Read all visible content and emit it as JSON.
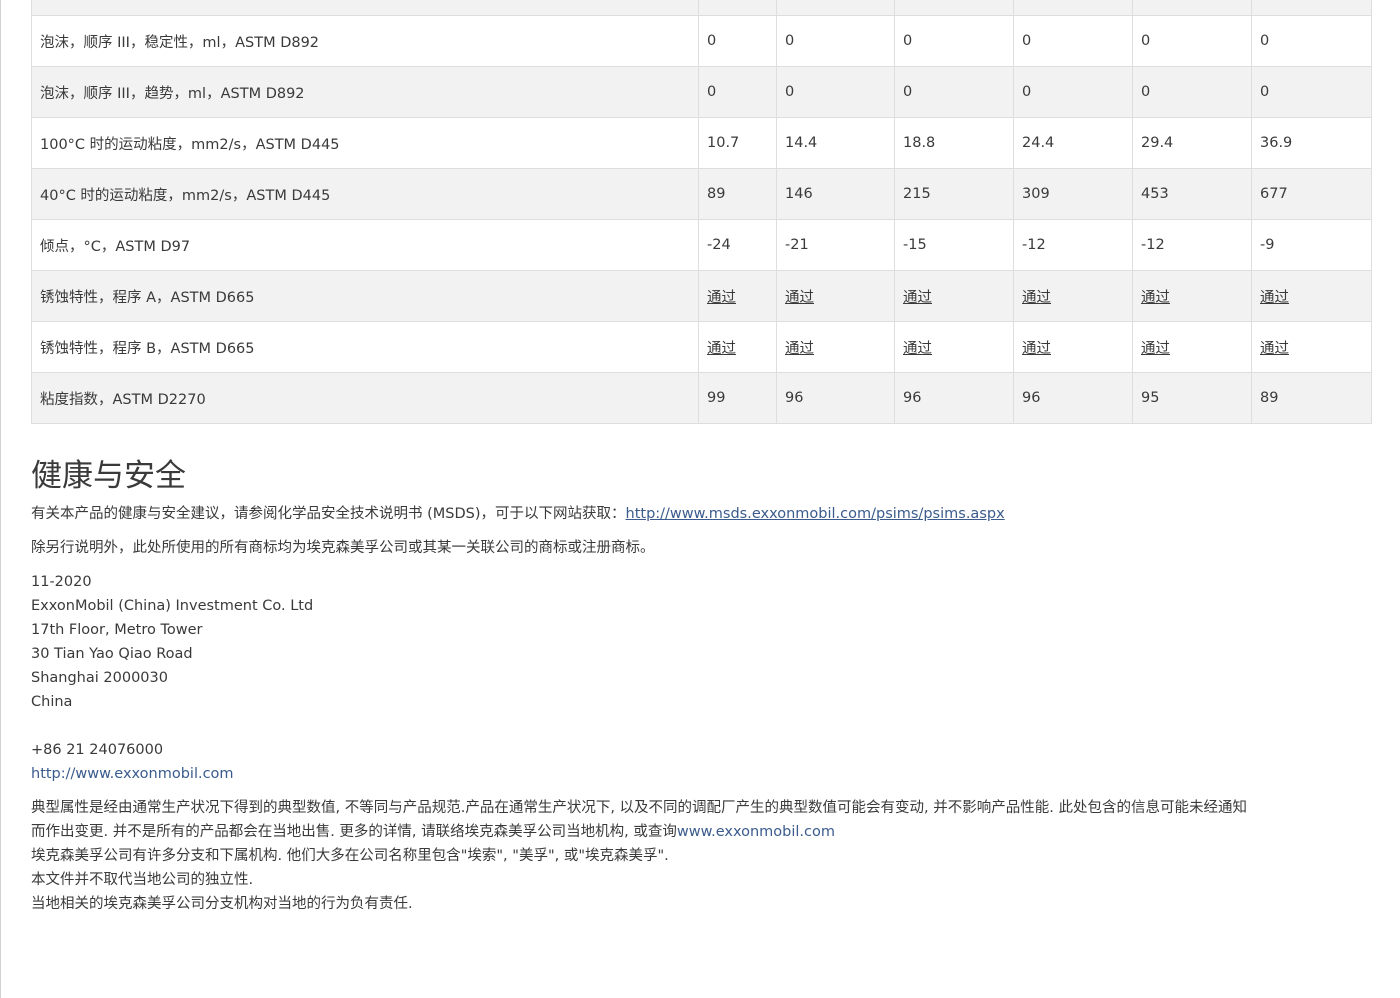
{
  "table": {
    "rows": [
      {
        "label": "",
        "values": [
          "",
          "",
          "",
          "",
          "",
          ""
        ]
      },
      {
        "label": "泡沫，顺序 III，稳定性，ml，ASTM D892",
        "values": [
          "0",
          "0",
          "0",
          "0",
          "0",
          "0"
        ]
      },
      {
        "label": "泡沫，顺序 III，趋势，ml，ASTM D892",
        "values": [
          "0",
          "0",
          "0",
          "0",
          "0",
          "0"
        ]
      },
      {
        "label": "100°C 时的运动粘度，mm2/s，ASTM D445",
        "values": [
          "10.7",
          "14.4",
          "18.8",
          "24.4",
          "29.4",
          "36.9"
        ]
      },
      {
        "label": "40°C 时的运动粘度，mm2/s，ASTM D445",
        "values": [
          "89",
          "146",
          "215",
          "309",
          "453",
          "677"
        ]
      },
      {
        "label": "倾点，°C，ASTM D97",
        "values": [
          "-24",
          "-21",
          "-15",
          "-12",
          "-12",
          "-9"
        ]
      },
      {
        "label": "锈蚀特性，程序 A，ASTM D665",
        "values": [
          "通过",
          "通过",
          "通过",
          "通过",
          "通过",
          "通过"
        ]
      },
      {
        "label": "锈蚀特性，程序 B，ASTM D665",
        "values": [
          "通过",
          "通过",
          "通过",
          "通过",
          "通过",
          "通过"
        ]
      },
      {
        "label": "粘度指数，ASTM D2270",
        "values": [
          "99",
          "96",
          "96",
          "96",
          "95",
          "89"
        ]
      }
    ]
  },
  "health": {
    "title": "健康与安全",
    "msds_text": "有关本产品的健康与安全建议，请参阅化学品安全技术说明书 (MSDS)，可于以下网站获取：",
    "msds_link": "http://www.msds.exxonmobil.com/psims/psims.aspx",
    "trademark_text": "除另行说明外，此处所使用的所有商标均为埃克森美孚公司或其某一关联公司的商标或注册商标。"
  },
  "address": {
    "date": "11-2020",
    "company": "ExxonMobil (China) Investment Co. Ltd",
    "line1": "17th Floor, Metro Tower",
    "line2": "30 Tian Yao Qiao Road",
    "city": "Shanghai 2000030",
    "country": "China",
    "phone": "+86 21 24076000",
    "website": "http://www.exxonmobil.com"
  },
  "disclaimer": {
    "line1": "典型属性是经由通常生产状况下得到的典型数值, 不等同与产品规范.产品在通常生产状况下, 以及不同的调配厂产生的典型数值可能会有变动, 并不影响产品性能. 此处包含的信息可能未经通知",
    "line2": "而作出变更. 并不是所有的产品都会在当地出售. 更多的详情, 请联络埃克森美孚公司当地机构, 或查询",
    "line2_link": "www.exxonmobil.com",
    "line3": "埃克森美孚公司有许多分支和下属机构. 他们大多在公司名称里包含\"埃索\", \"美孚\", 或\"埃克森美孚\".",
    "line4": "本文件并不取代当地公司的独立性.",
    "line5": "当地相关的埃克森美孚公司分支机构对当地的行为负有责任."
  }
}
